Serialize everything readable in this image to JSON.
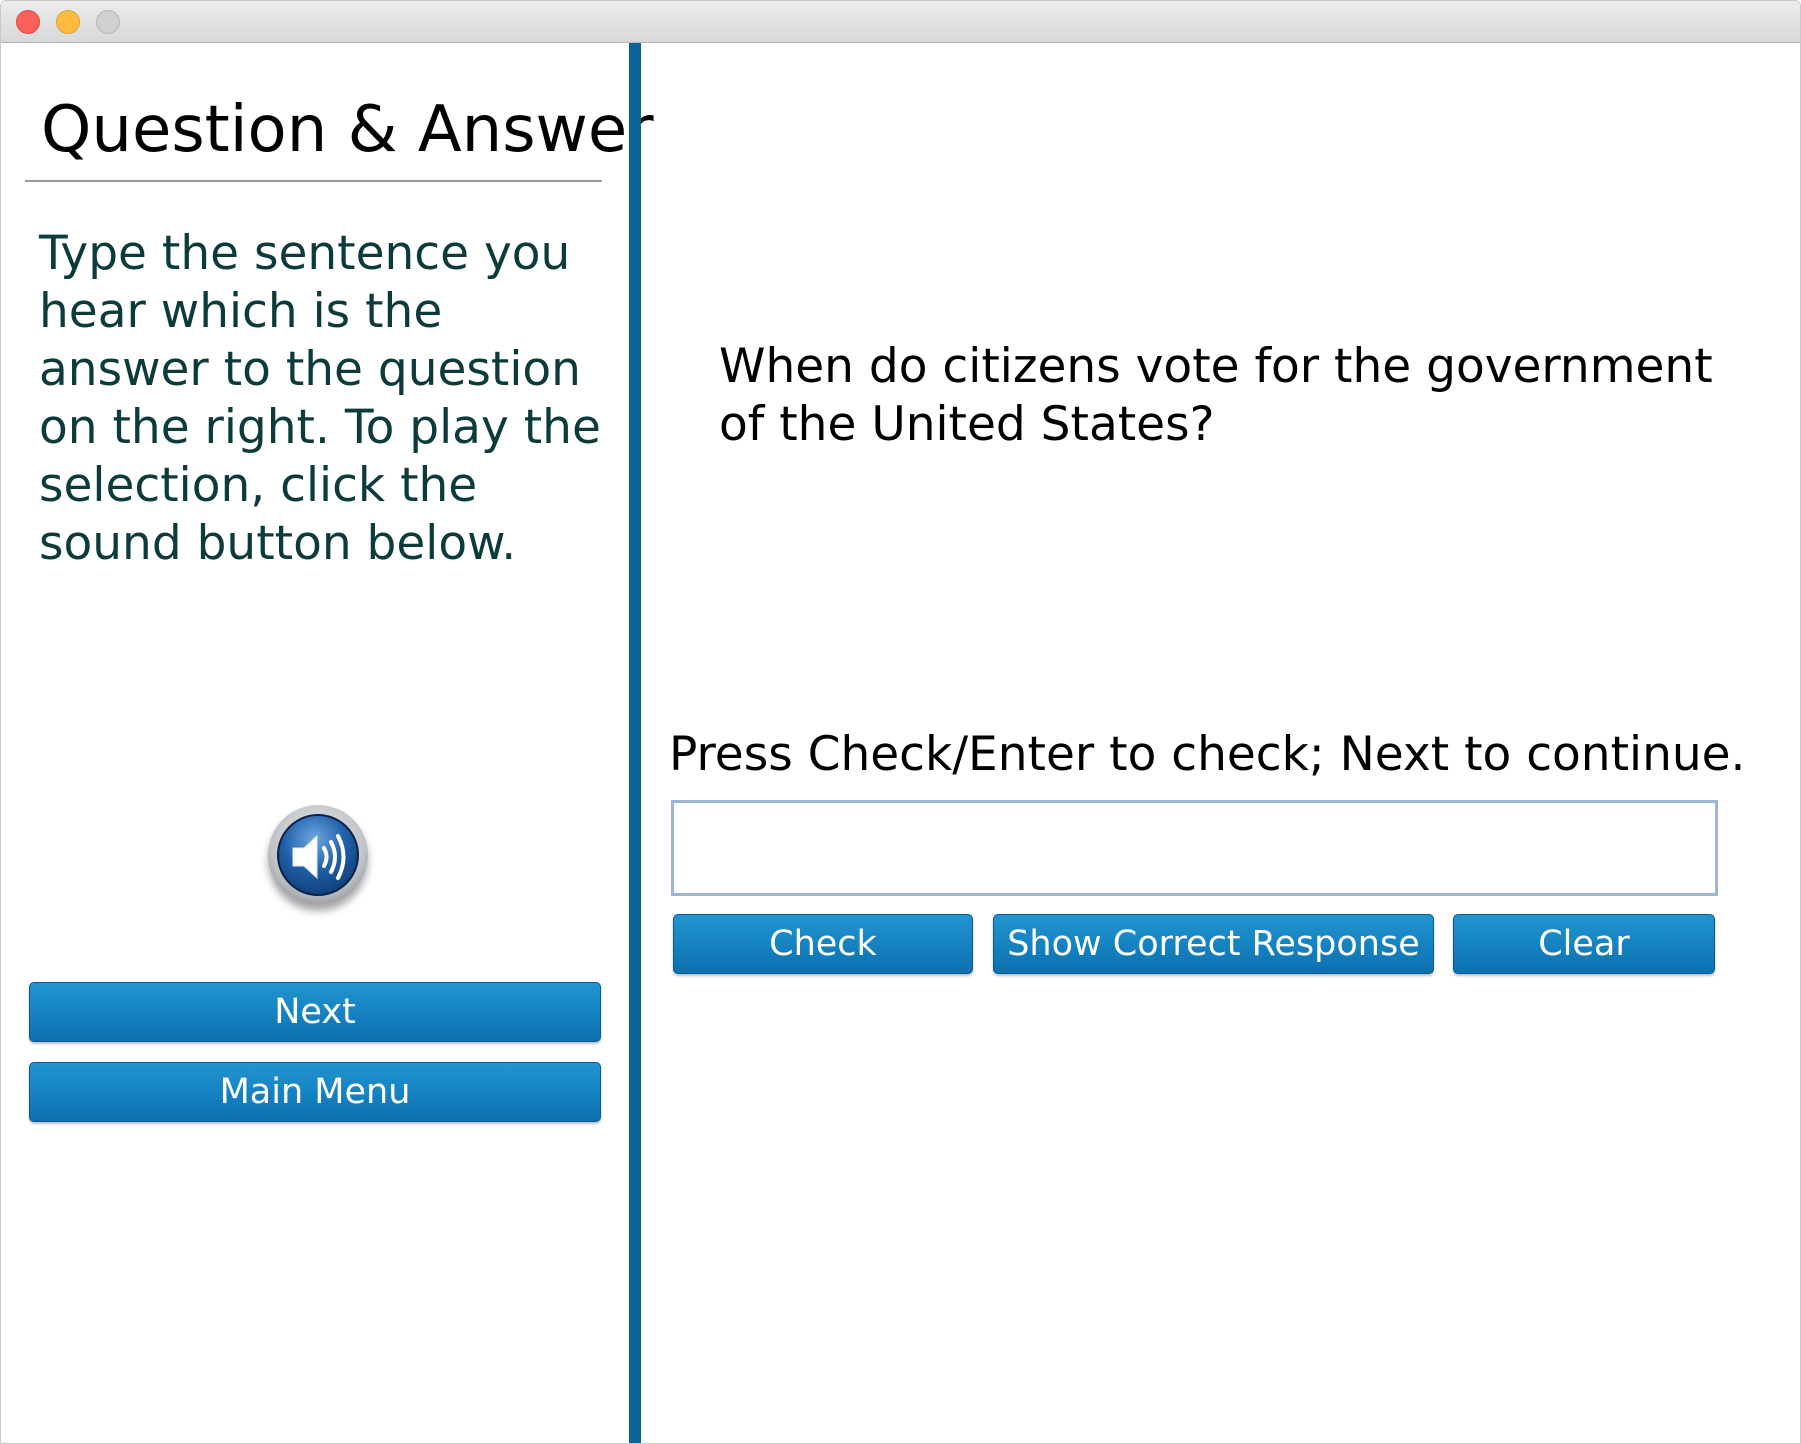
{
  "window": {
    "controls": [
      "close",
      "minimize",
      "zoom"
    ]
  },
  "left_panel": {
    "title": "Question & Answer",
    "instructions": "Type the sentence you hear which is the answer to the question on the right. To play the selection, click the sound button below.",
    "sound_icon": "speaker-icon",
    "next_label": "Next",
    "main_menu_label": "Main Menu"
  },
  "right_panel": {
    "question": "When do citizens vote for the government of the United States?",
    "prompt": "Press Check/Enter to check; Next to continue.",
    "answer_value": "",
    "check_label": "Check",
    "show_correct_label": "Show Correct Response",
    "clear_label": "Clear"
  },
  "colors": {
    "divider": "#0e629b",
    "button": "#1583c2",
    "instruction_text": "#0d3b3b"
  }
}
